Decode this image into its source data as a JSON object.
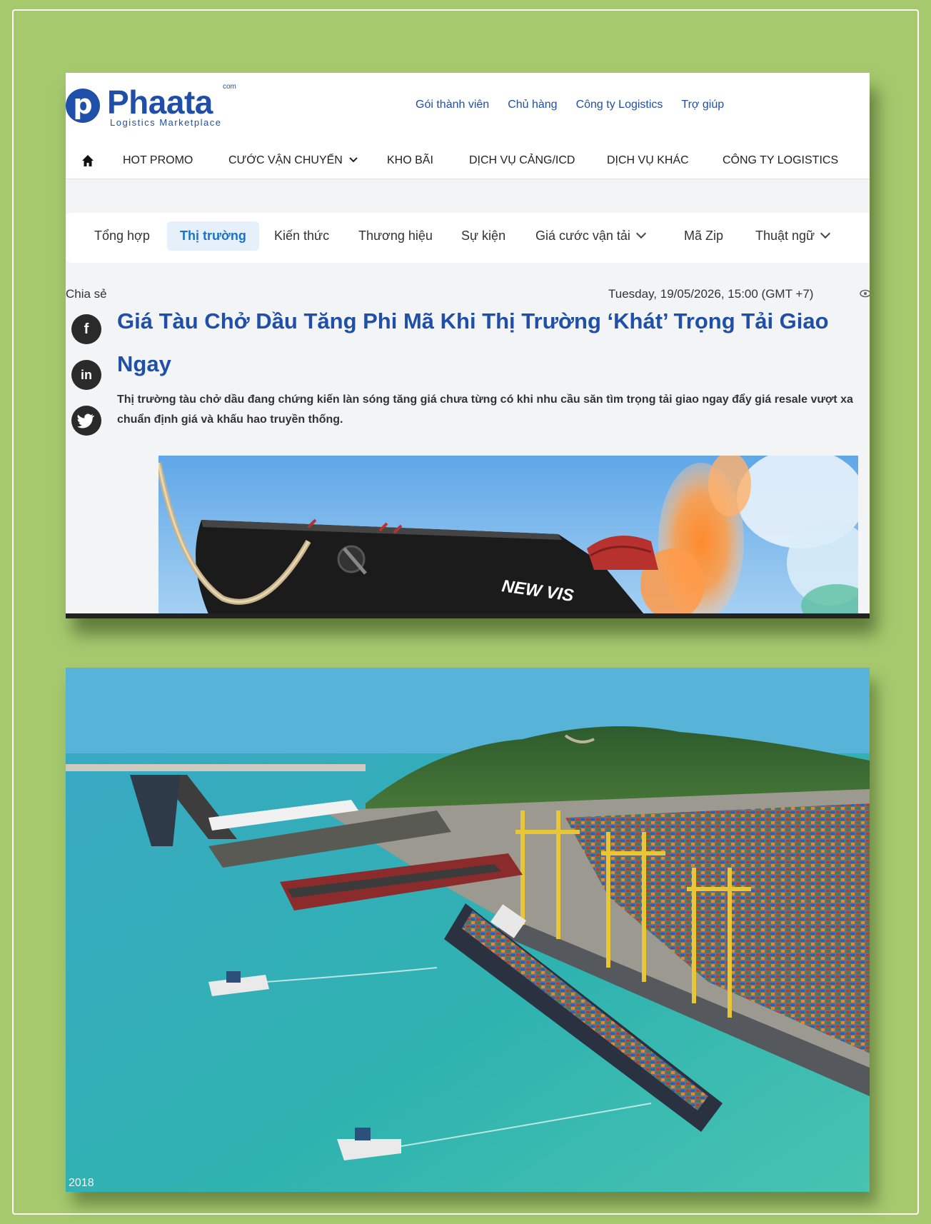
{
  "brand": {
    "badge_letter": "p",
    "name": "Phaata",
    "domain_suffix": "com",
    "tagline": "Logistics Marketplace"
  },
  "top_links": [
    "Gói thành viên",
    "Chủ hàng",
    "Công ty Logistics",
    "Trợ giúp"
  ],
  "main_nav": {
    "items": [
      "HOT PROMO",
      "CƯỚC VẬN CHUYỂN",
      "KHO BÃI",
      "DỊCH VỤ CẢNG/ICD",
      "DỊCH VỤ KHÁC",
      "CÔNG TY LOGISTICS"
    ]
  },
  "sub_nav": {
    "tabs": [
      "Tổng hợp",
      "Thị trường",
      "Kiến thức",
      "Thương hiệu",
      "Sự kiện",
      "Giá cước vận tải",
      "Mã Zip",
      "Thuật ngữ"
    ],
    "active_index": 1
  },
  "article": {
    "share_label": "Chia sẻ",
    "date": "Tuesday, 19/05/2026, 15:00 (GMT +7)",
    "title": "Giá Tàu Chở Dầu Tăng Phi Mã Khi Thị Trường ‘Khát’ Trọng Tải Giao Ngay",
    "summary": "Thị trường tàu chở dầu đang chứng kiến làn sóng tăng giá chưa từng có khi nhu cầu săn tìm trọng tải giao ngay đẩy giá resale vượt xa chuẩn định giá và khấu hao truyền thống.",
    "hero_ship_name": "NEW VIS",
    "social": [
      "f",
      "in",
      "t"
    ]
  },
  "port_photo": {
    "watermark": "2018"
  },
  "colors": {
    "background": "#a6c96e",
    "brand_blue": "#1f4fa8",
    "active_tab_bg": "#e6f0fa",
    "active_tab_text": "#1a73c9"
  }
}
